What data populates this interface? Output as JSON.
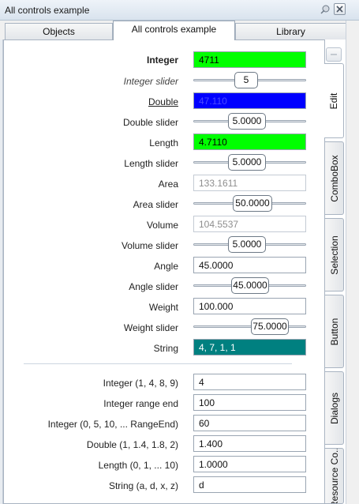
{
  "window": {
    "title": "All controls example"
  },
  "top_tabs": [
    "Objects",
    "All controls example",
    "Library"
  ],
  "side_tabs": [
    "Edit",
    "ComboBox",
    "Selection",
    "Button",
    "Dialogs",
    "Resource Co..."
  ],
  "rows1": [
    {
      "label": "Integer",
      "type": "input",
      "value": "4711",
      "bg": "#00ff00",
      "color": "#000000"
    },
    {
      "label": "Integer slider",
      "type": "slider",
      "value": "5"
    },
    {
      "label": "Double",
      "type": "input",
      "value": "47.110",
      "bg": "#0000ff",
      "color": "#4a4aff"
    },
    {
      "label": "Double slider",
      "type": "slider",
      "value": "5.0000"
    },
    {
      "label": "Length",
      "type": "input",
      "value": "4.7110",
      "bg": "#00ff00",
      "color": "#000000"
    },
    {
      "label": "Length slider",
      "type": "slider",
      "value": "5.0000"
    },
    {
      "label": "Area",
      "type": "readonly",
      "value": "133.1611"
    },
    {
      "label": "Area slider",
      "type": "slider",
      "value": "50.0000"
    },
    {
      "label": "Volume",
      "type": "readonly",
      "value": "104.5537"
    },
    {
      "label": "Volume slider",
      "type": "slider",
      "value": "5.0000"
    },
    {
      "label": "Angle",
      "type": "input",
      "value": "45.0000"
    },
    {
      "label": "Angle slider",
      "type": "slider",
      "value": "45.0000"
    },
    {
      "label": "Weight",
      "type": "input",
      "value": "100.000"
    },
    {
      "label": "Weight slider",
      "type": "slider",
      "value": "75.0000"
    },
    {
      "label": "String",
      "type": "input",
      "value": "4, 7, 1, 1",
      "bg": "#008080",
      "color": "#ffffff"
    }
  ],
  "rows2": [
    {
      "label": "Integer (1, 4, 8, 9)",
      "value": "4"
    },
    {
      "label": "Integer range end",
      "value": "100"
    },
    {
      "label": "Integer (0, 5, 10, ... RangeEnd)",
      "value": "60"
    },
    {
      "label": "Double (1, 1.4, 1.8, 2)",
      "value": "1.400"
    },
    {
      "label": "Length (0, 1, ... 10)",
      "value": "1.0000"
    },
    {
      "label": "String (a, d, x, z)",
      "value": "d"
    }
  ]
}
